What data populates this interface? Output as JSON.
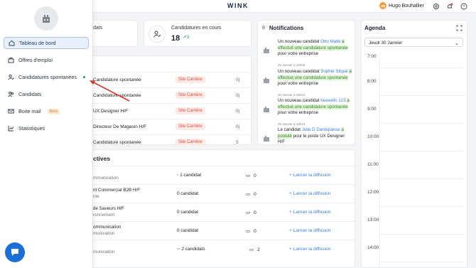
{
  "app": {
    "logo": "WINK"
  },
  "user": {
    "initials": "HB",
    "name": "Hugo Bouhallier"
  },
  "sidebar": {
    "items": [
      {
        "label": "Tableau de bord",
        "active": true,
        "icon": "home-icon"
      },
      {
        "label": "Offres d'emploi",
        "icon": "briefcase-icon"
      },
      {
        "label": "Candidatures spontanées",
        "icon": "user-pen-icon",
        "dot": true
      },
      {
        "label": "Candidats",
        "icon": "users-icon"
      },
      {
        "label": "Boite mail",
        "icon": "mail-icon",
        "badge": "Beta"
      },
      {
        "label": "Statistiques",
        "icon": "chart-icon"
      }
    ]
  },
  "stats": {
    "partial_title": "dats",
    "in_progress": {
      "title": "Candidatures en cours",
      "value": "18",
      "trend": "3"
    }
  },
  "applications": {
    "rows": [
      {
        "title": "Candidature spontanée",
        "tag": "Site Carrière",
        "date": "0j"
      },
      {
        "title": "Candidature spontanée",
        "tag": "Site Carrière",
        "date": "0j"
      },
      {
        "title": "UX Designer H/F",
        "tag": "Site Carrière",
        "date": "0j"
      },
      {
        "title": "Directeur De Magasin H/F",
        "tag": "Site Carrière",
        "date": "0j"
      },
      {
        "title": "Candidature spontanée",
        "tag": "Site Carrière",
        "date": "5"
      }
    ]
  },
  "notifications": {
    "count": "8",
    "title": "Notifications",
    "items": [
      {
        "pre": "Un nouveau candidat",
        "name": "Otto Matik",
        "hl": "a effectué une candidature spontanée",
        "post": "pour votre entreprise",
        "date": "30 Janvier à 16h09"
      },
      {
        "pre": "Un nouveau candidat",
        "name": "Sophie Stiqué",
        "hl": "a effectué une candidature spontanée",
        "post": "pour votre entreprise",
        "date": "30 Janvier à 15h34"
      },
      {
        "pre": "Un nouveau candidat",
        "name": "heeeello 123",
        "hl": "a effectué une candidature spontanée",
        "post": "pour votre entreprise",
        "date": "30 Janvier à 15h10"
      },
      {
        "pre": "Le candidat",
        "name": "Julie D Dantepanse",
        "hl": "a postulé",
        "post": "pour le poste UX Designer H/F",
        "date": ""
      }
    ]
  },
  "agenda": {
    "title": "Agenda",
    "date": "Jeudi 30 Janvier",
    "hours": [
      "7:00",
      "8:00",
      "9:00",
      "10:00",
      "11:00",
      "12:00",
      "13:00",
      "14:00"
    ]
  },
  "campaigns": {
    "title": "ctives",
    "launch_label": "Lancer la diffusion",
    "rows": [
      {
        "line1": "",
        "line2": "mmunication",
        "candidates": "1 candidat",
        "count": "0"
      },
      {
        "line1": "nt Commercial B2B H/F",
        "line2": "nte",
        "candidates": "0 candidat",
        "count": "0"
      },
      {
        "line1": "de Saveurs H/F",
        "line2": "ronnement",
        "candidates": "0 candidat",
        "count": "0"
      },
      {
        "line1": "ommunication",
        "line2": "munication",
        "candidates": "0 candidat",
        "count": "0"
      },
      {
        "line1": "",
        "line2": "munication",
        "candidates": "2 candidats",
        "count": "2"
      }
    ]
  }
}
